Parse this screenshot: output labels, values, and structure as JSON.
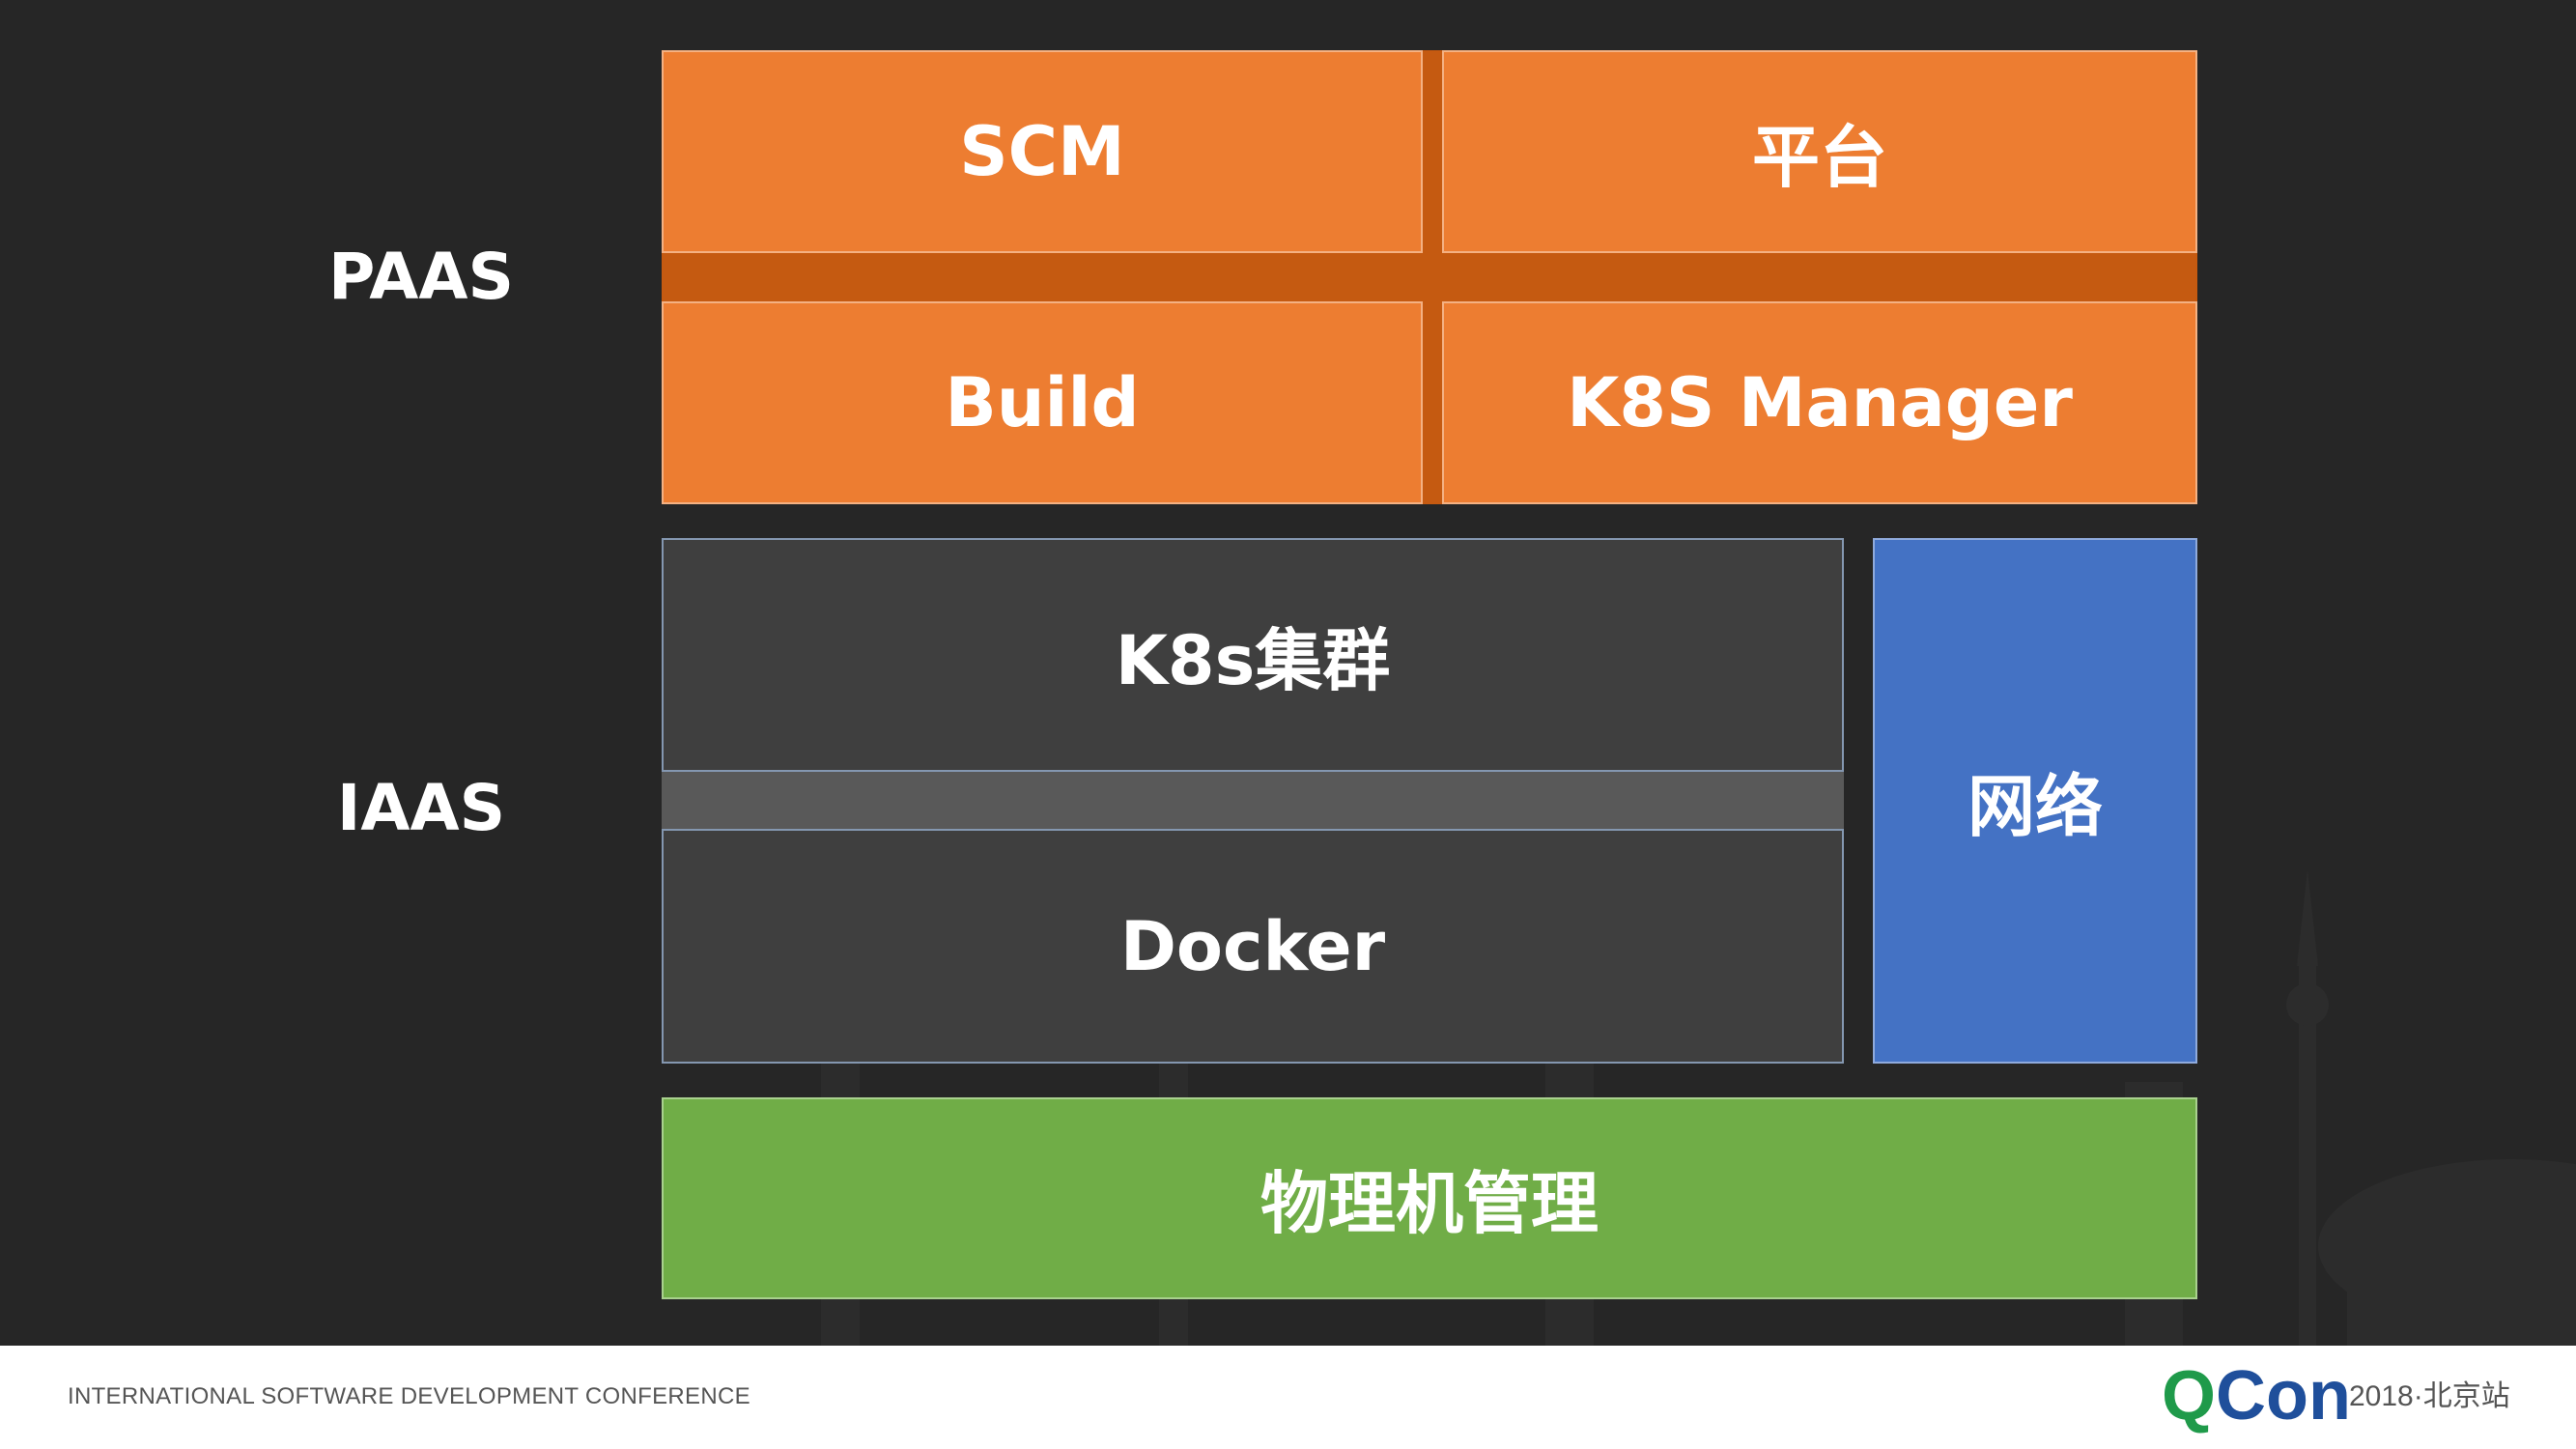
{
  "layers": {
    "paas": "PAAS",
    "iaas": "IAAS"
  },
  "paas_blocks": {
    "scm": "SCM",
    "platform": "平台",
    "build": "Build",
    "k8s_manager": "K8S Manager"
  },
  "iaas_blocks": {
    "k8s_cluster": "K8s集群",
    "docker": "Docker",
    "network": "网络"
  },
  "base_block": {
    "physical_management": "物理机管理"
  },
  "footer": {
    "conference": "INTERNATIONAL SOFTWARE DEVELOPMENT CONFERENCE",
    "logo_q": "Q",
    "logo_con": "Con",
    "logo_sub": "2018·北京站"
  },
  "colors": {
    "orange": "#ED7D31",
    "dark_orange": "#C55A11",
    "gray": "#3F3F3F",
    "blue": "#4472C4",
    "green": "#70AD47",
    "background": "#262626"
  }
}
